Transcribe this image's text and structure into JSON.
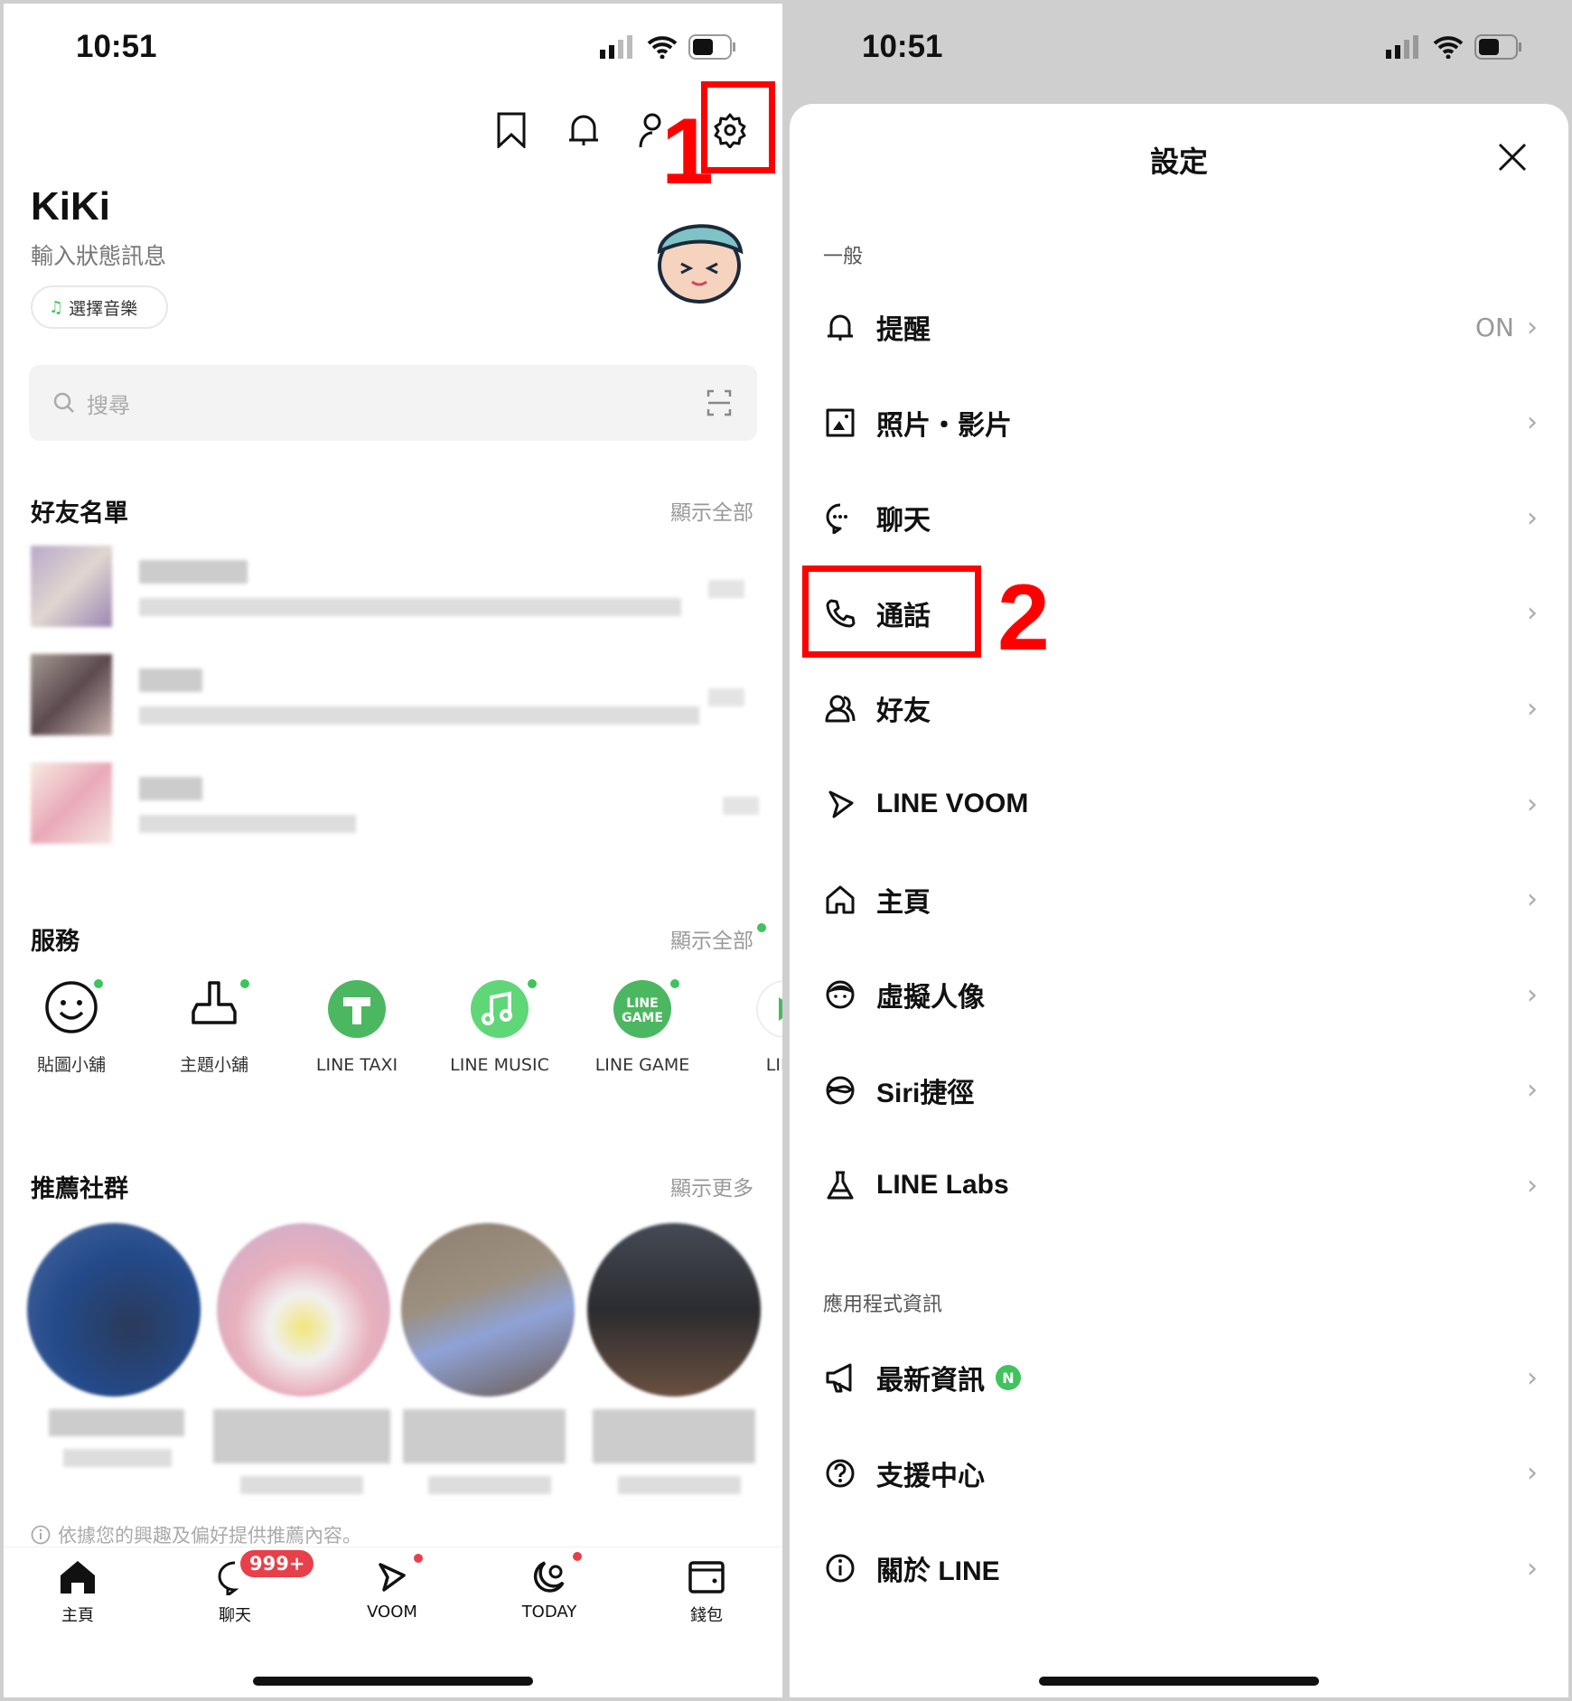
{
  "status": {
    "time": "10:51"
  },
  "annotations": {
    "step1": "1",
    "step2": "2"
  },
  "profile": {
    "name": "KiKi",
    "status_placeholder": "輸入狀態訊息",
    "music_button": "選擇音樂"
  },
  "search": {
    "placeholder": "搜尋"
  },
  "friends": {
    "title": "好友名單",
    "show_all": "顯示全部"
  },
  "services": {
    "title": "服務",
    "show_all": "顯示全部",
    "items": [
      {
        "label": "貼圖小舖",
        "icon": "smiley-icon",
        "dot": true
      },
      {
        "label": "主題小舖",
        "icon": "brush-icon",
        "dot": true
      },
      {
        "label": "LINE TAXI",
        "icon": "taxi-icon",
        "dot": false
      },
      {
        "label": "LINE MUSIC",
        "icon": "music-icon",
        "dot": true
      },
      {
        "label": "LINE GAME",
        "icon": "game-icon",
        "dot": true
      },
      {
        "label": "LINE",
        "icon": "play-icon",
        "dot": false
      }
    ]
  },
  "communities": {
    "title": "推薦社群",
    "show_more": "顯示更多",
    "note": "依據您的興趣及偏好提供推薦內容。"
  },
  "bottom_nav": [
    {
      "label": "主頁"
    },
    {
      "label": "聊天",
      "badge": "999+"
    },
    {
      "label": "VOOM"
    },
    {
      "label": "TODAY"
    },
    {
      "label": "錢包"
    }
  ],
  "settings": {
    "title": "設定",
    "general_header": "一般",
    "app_info_header": "應用程式資訊",
    "general": [
      {
        "label": "提醒",
        "value": "ON",
        "icon": "bell-icon"
      },
      {
        "label": "照片・影片",
        "icon": "photo-icon"
      },
      {
        "label": "聊天",
        "icon": "chat-icon"
      },
      {
        "label": "通話",
        "icon": "phone-icon"
      },
      {
        "label": "好友",
        "icon": "friends-icon"
      },
      {
        "label": "LINE VOOM",
        "icon": "voom-icon"
      },
      {
        "label": "主頁",
        "icon": "home-icon"
      },
      {
        "label": "虛擬人像",
        "icon": "avatar-icon"
      },
      {
        "label": "Siri捷徑",
        "icon": "siri-icon"
      },
      {
        "label": "LINE Labs",
        "icon": "flask-icon"
      }
    ],
    "app_info": [
      {
        "label": "最新資訊",
        "badge": "N",
        "icon": "megaphone-icon"
      },
      {
        "label": "支援中心",
        "icon": "help-icon"
      },
      {
        "label": "關於 LINE",
        "icon": "info-icon"
      }
    ]
  },
  "colors": {
    "accent_green": "#3fc35b",
    "annotation_red": "#ff0000",
    "badge_red": "#e8404a"
  }
}
